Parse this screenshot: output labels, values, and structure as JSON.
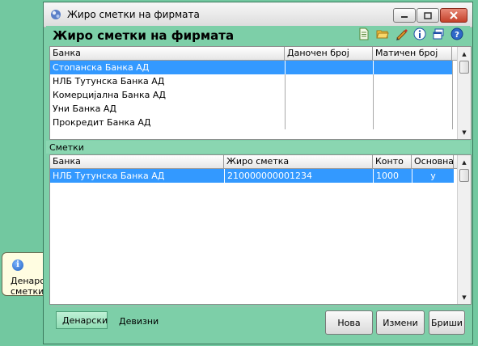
{
  "window": {
    "title": "Жиро сметки на фирмата",
    "header_title": "Жиро сметки на фирмата"
  },
  "toolbar_icons": [
    "new-document-icon",
    "open-folder-icon",
    "edit-pencil-icon",
    "info-icon",
    "restore-window-icon",
    "help-icon"
  ],
  "banks_grid": {
    "columns": [
      "Банка",
      "Даночен број",
      "Матичен број"
    ],
    "rows": [
      [
        "Стопанска Банка АД",
        "",
        ""
      ],
      [
        "НЛБ Тутунска Банка АД",
        "",
        ""
      ],
      [
        "Комерцијална Банка АД",
        "",
        ""
      ],
      [
        "Уни Банка АД",
        "",
        ""
      ],
      [
        "Прокредит Банка АД",
        "",
        ""
      ]
    ],
    "selected_row": 0
  },
  "accounts_section_label": "Сметки",
  "accounts_grid": {
    "columns": [
      "Банка",
      "Жиро сметка",
      "Конто",
      "Основна"
    ],
    "rows": [
      [
        "НЛБ Тутунска Банка АД",
        "210000000001234",
        "1000",
        "y"
      ]
    ],
    "selected_row": 0
  },
  "tabs": {
    "denarski": "Денарски",
    "devizni": "Девизни"
  },
  "buttons": {
    "new": "Нова",
    "edit": "Измени",
    "delete": "Бриши"
  },
  "tooltip": {
    "text": "Денарски жиро сметки"
  },
  "colors": {
    "background": "#72c8a0",
    "selection": "#3399ff",
    "tooltip_bg": "#fffde1"
  }
}
